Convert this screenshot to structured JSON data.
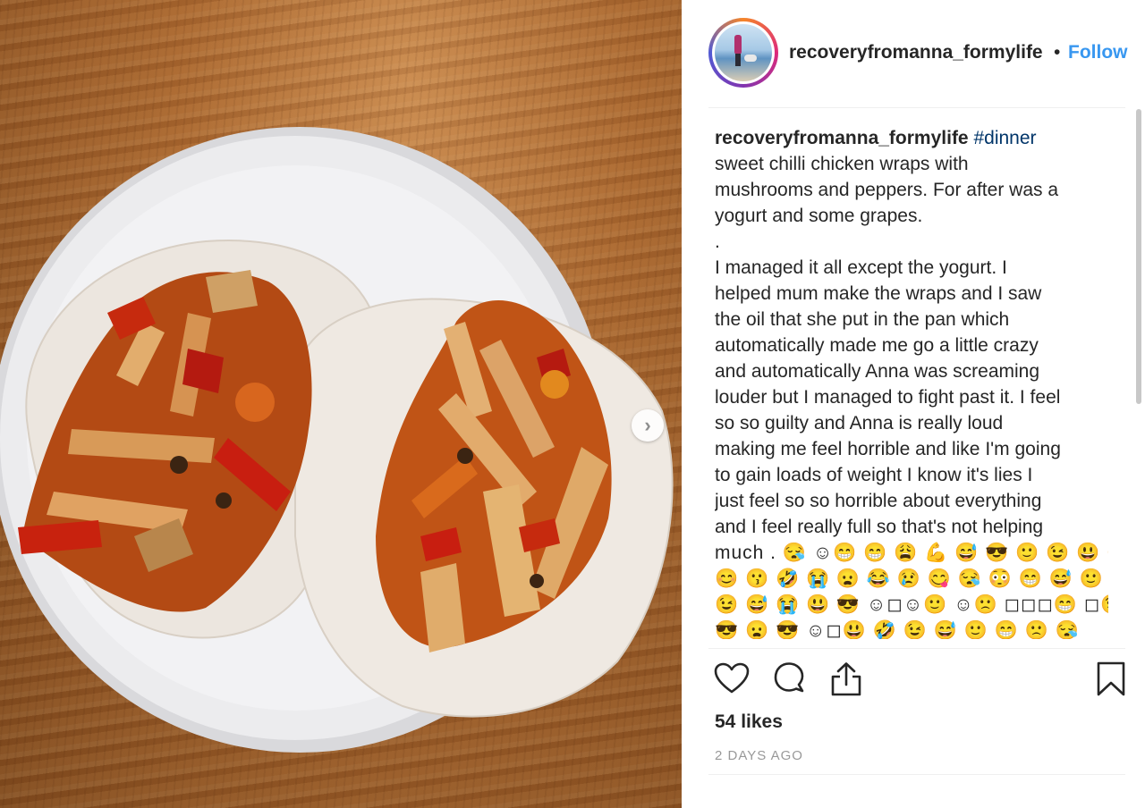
{
  "post": {
    "photo_alt": "",
    "next_icon": "chevron-right-icon"
  },
  "header": {
    "username": "recoveryfromanna_formylife",
    "separator": "•",
    "follow_label": "Follow"
  },
  "caption": {
    "username": "recoveryfromanna_formylife",
    "hashtag": "#dinner",
    "lines": [
      "sweet chilli chicken wraps with",
      "mushrooms and peppers. For after was a",
      "yogurt and some grapes.",
      ".",
      "I managed it all except the yogurt. I",
      "helped mum make the wraps and I saw",
      "the oil that she put in the pan which",
      "automatically made me go a little crazy",
      "and automatically Anna was screaming",
      "louder but I managed to fight past it. I feel",
      "so so guilty and Anna is really loud",
      "making me feel horrible and like I'm going",
      "to gain loads of weight I know it's lies I",
      "just feel so so horrible about everything",
      "and I feel really full so that's not helping"
    ],
    "emoji_lines": [
      "much . 😪 ☺😁 😁 😩 💪 😅 😎 🙂 😉 😃 😆",
      "😊 😗 🤣 😭 😦 😂 😢 😋 😪 😳 😁 😅 🙂 🤣",
      "😉 😅 😭 😃 😎 ☺◻☺🙂 ☺🙁 ◻◻◻😁 ◻😉",
      "😎 😦 😎 ☺◻😃 🤣 😉 😅 🙂 😁 🙁 😪"
    ]
  },
  "actions": {
    "like_icon": "heart-icon",
    "comment_icon": "comment-icon",
    "share_icon": "share-icon",
    "save_icon": "bookmark-icon"
  },
  "likes": "54 likes",
  "date": "2 DAYS AGO",
  "colors": {
    "link": "#3897f0",
    "hashtag": "#003569",
    "meta": "#999999"
  }
}
